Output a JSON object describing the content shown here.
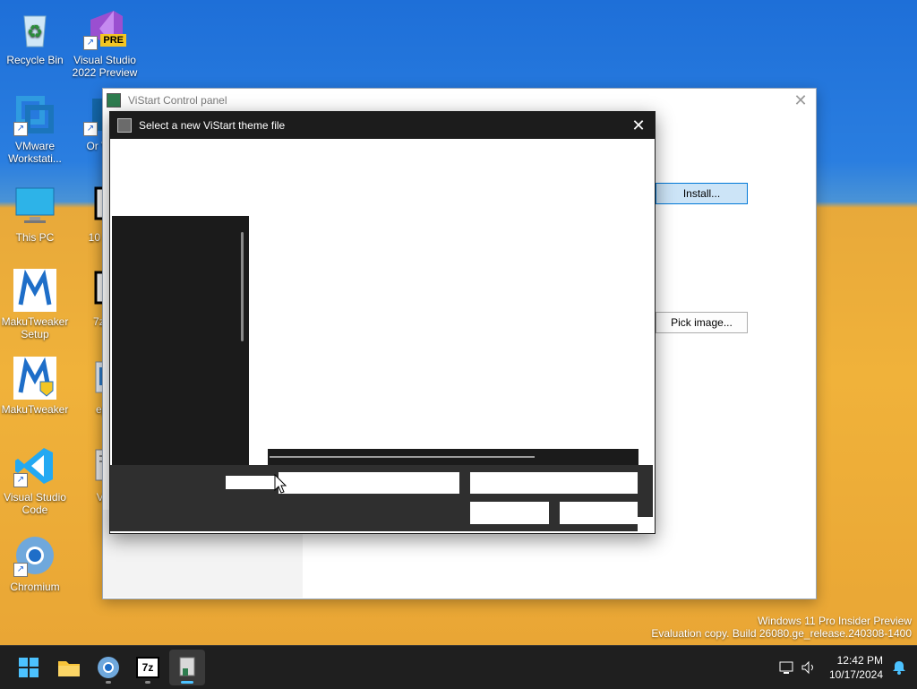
{
  "desktop": {
    "icons": [
      {
        "label": "Recycle Bin",
        "icon": "recycle-bin-icon"
      },
      {
        "label": "Visual Studio 2022 Preview",
        "icon": "visual-studio-preview-icon",
        "badge": "PRE"
      },
      {
        "label": "VMware Workstati...",
        "icon": "vmware-icon"
      },
      {
        "label": "Or Virtu",
        "icon": "oracle-virtualbox-icon"
      },
      {
        "label": "This PC",
        "icon": "this-pc-icon"
      },
      {
        "label": "10 Lon",
        "icon": "seven-zip-file-icon"
      },
      {
        "label": "MakuTweaker Setup",
        "icon": "makutweaker-setup-icon"
      },
      {
        "label": "7z24",
        "icon": "seven-zip-file-icon"
      },
      {
        "label": "MakuTweaker",
        "icon": "makutweaker-icon"
      },
      {
        "label": "ep_",
        "icon": "ep-file-icon"
      },
      {
        "label": "Visual Studio Code",
        "icon": "vscode-icon"
      },
      {
        "label": "ViS",
        "icon": "vistart-file-icon"
      },
      {
        "label": "Chromium",
        "icon": "chromium-icon"
      }
    ]
  },
  "control_panel": {
    "title": "ViStart Control panel",
    "install_label": "Install...",
    "pick_image_label": "Pick image..."
  },
  "dialog": {
    "title": "Select a new ViStart theme file"
  },
  "watermark": {
    "line1": "Windows 11 Pro Insider Preview",
    "line2": "Evaluation copy. Build 26080.ge_release.240308-1400"
  },
  "taskbar": {
    "apps": [
      {
        "name": "start",
        "icon": "windows-start-icon"
      },
      {
        "name": "file-explorer",
        "icon": "folder-icon"
      },
      {
        "name": "chromium",
        "icon": "chromium-icon"
      },
      {
        "name": "7-zip",
        "icon": "seven-zip-icon",
        "glyph": "7z"
      },
      {
        "name": "vistart",
        "icon": "vistart-icon"
      }
    ],
    "time": "12:42 PM",
    "date": "10/17/2024"
  },
  "colors": {
    "accent": "#0078d7",
    "dialog_dark": "#1c1c1c",
    "footer_dark": "#2f2f2f",
    "taskbar": "#1f1f1f"
  }
}
